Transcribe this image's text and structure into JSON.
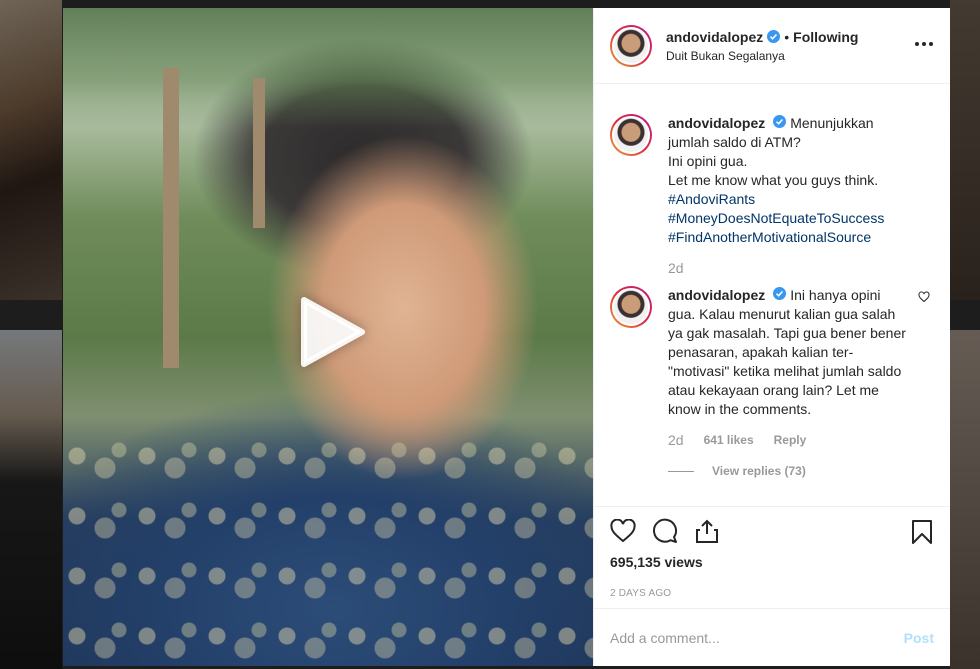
{
  "post": {
    "username": "andovidalopez",
    "follow_status": "Following",
    "location": "Duit Bukan Segalanya",
    "caption": {
      "lines": [
        "Menunjukkan jumlah saldo di ATM?",
        "Ini opini gua.",
        "Let me know what you guys think."
      ],
      "hashtags": [
        "#AndoviRants",
        "#MoneyDoesNotEquateToSuccess",
        "#FindAnotherMotivationalSource"
      ],
      "time": "2d"
    },
    "comment": {
      "username": "andovidalopez",
      "text": "Ini hanya opini gua. Kalau menurut kalian gua salah ya gak masalah. Tapi gua bener bener penasaran, apakah kalian ter-\"motivasi\" ketika melihat jumlah saldo atau kekayaan orang lain? Let me know in the comments.",
      "time": "2d",
      "likes": "641 likes",
      "reply_label": "Reply",
      "view_replies": "View replies (73)"
    },
    "views": "695,135 views",
    "time_ago": "2 DAYS AGO",
    "add_comment_placeholder": "Add a comment...",
    "post_label": "Post"
  },
  "icons": {
    "play": "play-icon",
    "verified": "verified-badge-icon",
    "more": "more-options-icon",
    "like": "heart-icon",
    "comment": "comment-icon",
    "share": "share-icon",
    "save": "bookmark-icon",
    "comment_like": "heart-icon"
  },
  "colors": {
    "link": "#003569",
    "verified": "#3897f0",
    "post_disabled": "#b2dffc",
    "muted": "#999999"
  }
}
